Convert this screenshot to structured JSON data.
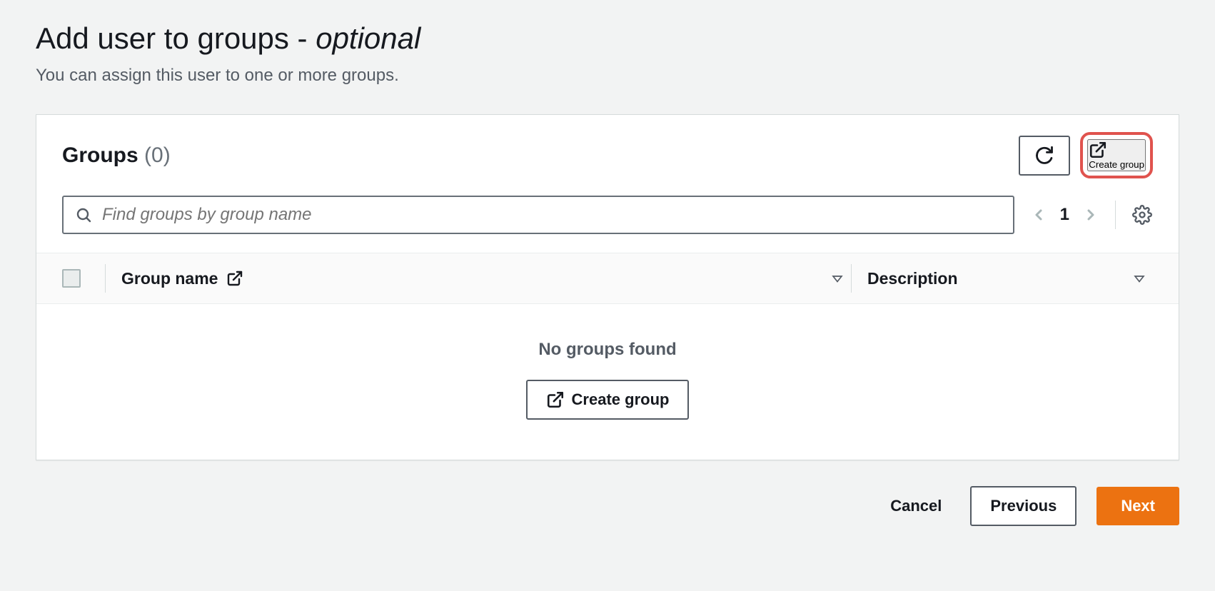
{
  "page": {
    "title_main": "Add user to groups",
    "title_separator": " - ",
    "title_optional": "optional",
    "subtitle": "You can assign this user to one or more groups."
  },
  "panel": {
    "title": "Groups",
    "count": "(0)",
    "create_group_label": "Create group"
  },
  "search": {
    "placeholder": "Find groups by group name"
  },
  "pagination": {
    "page": "1"
  },
  "table": {
    "col_group_name": "Group name",
    "col_description": "Description",
    "empty_message": "No groups found",
    "empty_action": "Create group"
  },
  "footer": {
    "cancel": "Cancel",
    "previous": "Previous",
    "next": "Next"
  }
}
